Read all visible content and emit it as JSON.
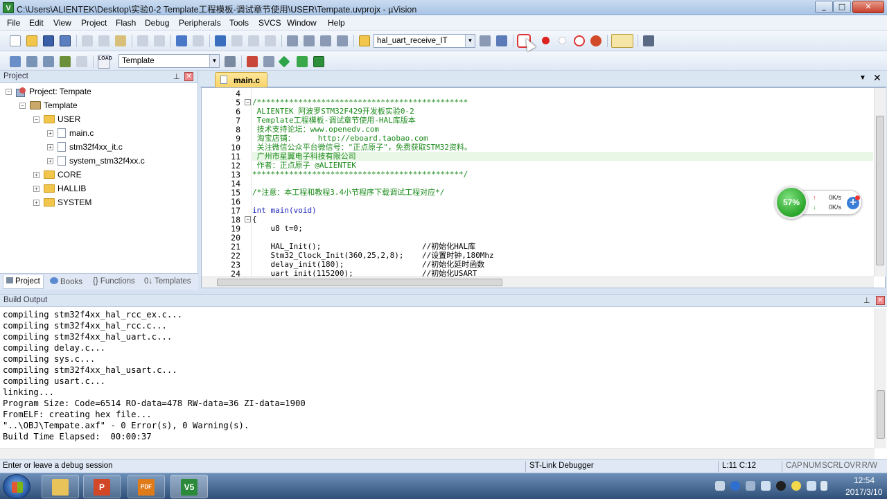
{
  "window": {
    "title": "C:\\Users\\ALIENTEK\\Desktop\\实验0-2 Template工程模板-调试章节使用\\USER\\Tempate.uvprojx - µVision",
    "app_icon_letter": "V",
    "min": "_",
    "max": "□",
    "close": "✕"
  },
  "menu": [
    "File",
    "Edit",
    "View",
    "Project",
    "Flash",
    "Debug",
    "Peripherals",
    "Tools",
    "SVCS",
    "Window",
    "Help"
  ],
  "toolbar": {
    "find_combo": "hal_uart_receive_IT",
    "target_combo": "Template",
    "load_label": "LOAD",
    "icons": [
      "new-file-icon",
      "open-folder-icon",
      "save-icon",
      "save-all-icon",
      "cut-icon",
      "copy-icon",
      "paste-icon",
      "undo-icon",
      "redo-icon",
      "nav-back-icon",
      "nav-forward-icon",
      "bookmark-icon",
      "indent-icon",
      "outdent-icon",
      "comment-icon",
      "uncomment-icon",
      "find-in-files-icon",
      "debug-session-icon",
      "breakpoint-icon",
      "kill-breakpoints-icon",
      "window-layout-icon",
      "config-wrench-icon",
      "translate-icon",
      "build-icon",
      "rebuild-icon",
      "batch-build-icon",
      "download-icon",
      "target-options-icon",
      "manage-components-icon",
      "pack-installer-icon",
      "select-software-packs-icon"
    ]
  },
  "project_panel": {
    "title": "Project",
    "pin": "⊥",
    "close": "✕",
    "tree": [
      {
        "label": "Project: Tempate",
        "type": "project",
        "level": 0,
        "toggle": "−"
      },
      {
        "label": "Template",
        "type": "target",
        "level": 1,
        "toggle": "−"
      },
      {
        "label": "USER",
        "type": "folder",
        "level": 2,
        "toggle": "−"
      },
      {
        "label": "main.c",
        "type": "file",
        "level": 3,
        "toggle": "+"
      },
      {
        "label": "stm32f4xx_it.c",
        "type": "file",
        "level": 3,
        "toggle": "+"
      },
      {
        "label": "system_stm32f4xx.c",
        "type": "file",
        "level": 3,
        "toggle": "+"
      },
      {
        "label": "CORE",
        "type": "folder",
        "level": 2,
        "toggle": "+"
      },
      {
        "label": "HALLIB",
        "type": "folder",
        "level": 2,
        "toggle": "+"
      },
      {
        "label": "SYSTEM",
        "type": "folder",
        "level": 2,
        "toggle": "+"
      }
    ],
    "tabs": [
      "Project",
      "Books",
      "{} Functions",
      "0↓ Templates"
    ]
  },
  "editor": {
    "tab_label": "main.c",
    "dropdown": "▼",
    "close": "✕",
    "lines": [
      {
        "n": "4",
        "text": ""
      },
      {
        "n": "5",
        "text": "/**********************************************",
        "cls": "comment",
        "fold": "−"
      },
      {
        "n": "6",
        "text": " ALIENTEK 阿波罗STM32F429开发板实验0-2",
        "cls": "comment"
      },
      {
        "n": "7",
        "text": " Template工程模板-调试章节使用-HAL库版本",
        "cls": "comment"
      },
      {
        "n": "8",
        "text": " 技术支持论坛：www.openedv.com",
        "cls": "comment"
      },
      {
        "n": "9",
        "text": " 淘宝店铺：     http://eboard.taobao.com",
        "cls": "comment"
      },
      {
        "n": "10",
        "text": " 关注微信公众平台微信号：\"正点原子\"，免费获取STM32资料。",
        "cls": "comment"
      },
      {
        "n": "11",
        "text": " 广州市星翼电子科技有限公司",
        "cls": "comment",
        "highlight": true
      },
      {
        "n": "12",
        "text": " 作者：正点原子 @ALIENTEK",
        "cls": "comment"
      },
      {
        "n": "13",
        "text": "**********************************************/",
        "cls": "comment"
      },
      {
        "n": "14",
        "text": ""
      },
      {
        "n": "15",
        "text": "/*注意：本工程和教程3.4小节程序下载调试工程对应*/",
        "cls": "comment"
      },
      {
        "n": "16",
        "text": ""
      },
      {
        "n": "17",
        "text": "int main(void)",
        "cls": "kw"
      },
      {
        "n": "18",
        "text": "{",
        "fold": "−"
      },
      {
        "n": "19",
        "text": "    u8 t=0;"
      },
      {
        "n": "20",
        "text": ""
      },
      {
        "n": "21",
        "text": "    HAL_Init();                      //初始化HAL库"
      },
      {
        "n": "22",
        "text": "    Stm32_Clock_Init(360,25,2,8);    //设置时钟,180Mhz"
      },
      {
        "n": "23",
        "text": "    delay_init(180);                 //初始化延时函数"
      },
      {
        "n": "24",
        "text": "    uart_init(115200);               //初始化USART"
      }
    ]
  },
  "net_widget": {
    "percent": "57%",
    "upload": "0K/s",
    "download": "0K/s",
    "up_arrow": "↑",
    "down_arrow": "↓",
    "plus": "+"
  },
  "build_output": {
    "title": "Build Output",
    "pin": "⊥",
    "close": "✕",
    "lines": [
      "compiling stm32f4xx_hal_rcc_ex.c...",
      "compiling stm32f4xx_hal_rcc.c...",
      "compiling stm32f4xx_hal_uart.c...",
      "compiling delay.c...",
      "compiling sys.c...",
      "compiling stm32f4xx_hal_usart.c...",
      "compiling usart.c...",
      "linking...",
      "Program Size: Code=6514 RO-data=478 RW-data=36 ZI-data=1900",
      "FromELF: creating hex file...",
      "\"..\\OBJ\\Tempate.axf\" - 0 Error(s), 0 Warning(s).",
      "Build Time Elapsed:  00:00:37"
    ]
  },
  "status": {
    "hint": "Enter or leave a debug session",
    "debugger": "ST-Link Debugger",
    "position": "L:11 C:12",
    "flags": "CAP  NUM  SCRL  OVR  R/W"
  },
  "taskbar": {
    "apps": [
      {
        "name": "explorer",
        "label": ""
      },
      {
        "name": "powerpoint",
        "label": "P"
      },
      {
        "name": "pdf",
        "label": "PDF"
      },
      {
        "name": "keil",
        "label": "V5"
      }
    ],
    "clock_time": "12:54",
    "clock_date": "2017/3/10"
  },
  "colors": {
    "accent": "#dbe6f3",
    "comment": "#1a8a1a",
    "keyword": "#1a23b8",
    "highlight_line": "#e9f7e7"
  }
}
